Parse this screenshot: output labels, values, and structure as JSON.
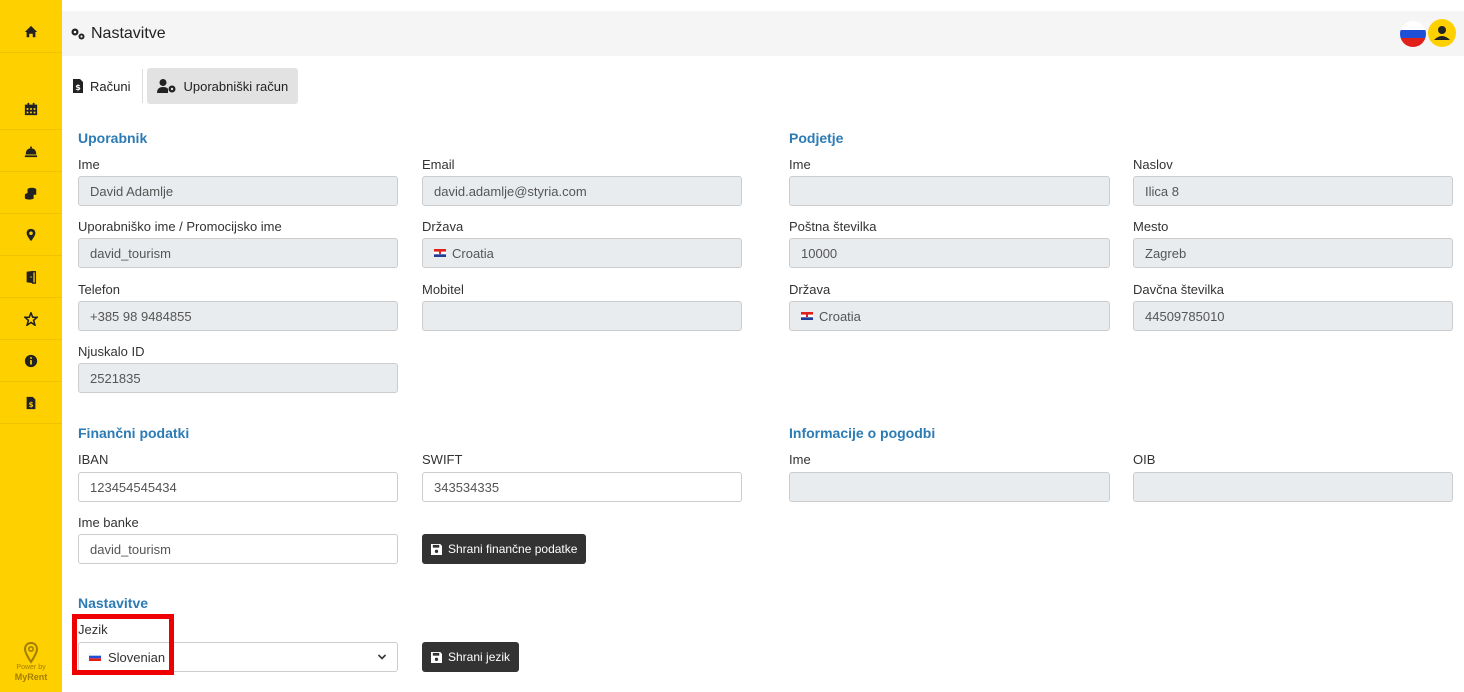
{
  "sidebar": {
    "items": [
      {
        "icon": "home-icon"
      },
      {
        "icon": "calendar-icon"
      },
      {
        "icon": "bell-icon"
      },
      {
        "icon": "coins-icon"
      },
      {
        "icon": "map-marker-icon"
      },
      {
        "icon": "door-icon"
      },
      {
        "icon": "star-icon"
      },
      {
        "icon": "info-icon"
      },
      {
        "icon": "invoice-icon"
      }
    ],
    "power_by": "Power by",
    "brand": "MyRent"
  },
  "header": {
    "title": "Nastavitve"
  },
  "tabs": [
    {
      "label": "Računi"
    },
    {
      "label": "Uporabniški račun"
    }
  ],
  "user": {
    "section": "Uporabnik",
    "name_label": "Ime",
    "name_value": "David Adamlje",
    "email_label": "Email",
    "email_value": "david.adamlje@styria.com",
    "username_label": "Uporabniško ime / Promocijsko ime",
    "username_value": "david_tourism",
    "country_label": "Država",
    "country_value": "Croatia",
    "phone_label": "Telefon",
    "phone_value": "+385 98 9484855",
    "mobile_label": "Mobitel",
    "mobile_value": "",
    "njuskalo_label": "Njuskalo ID",
    "njuskalo_value": "2521835"
  },
  "company": {
    "section": "Podjetje",
    "name_label": "Ime",
    "name_value": "",
    "address_label": "Naslov",
    "address_value": "Ilica 8",
    "postal_label": "Poštna številka",
    "postal_value": "10000",
    "city_label": "Mesto",
    "city_value": "Zagreb",
    "country_label": "Država",
    "country_value": "Croatia",
    "tax_label": "Davčna številka",
    "tax_value": "44509785010"
  },
  "finance": {
    "section": "Finančni podatki",
    "iban_label": "IBAN",
    "iban_value": "123454545434",
    "swift_label": "SWIFT",
    "swift_value": "343534335",
    "bank_label": "Ime banke",
    "bank_value": "david_tourism",
    "save_button": "Shrani finančne podatke"
  },
  "contract": {
    "section": "Informacije o pogodbi",
    "name_label": "Ime",
    "name_value": "",
    "oib_label": "OIB",
    "oib_value": ""
  },
  "settings": {
    "section": "Nastavitve",
    "language_label": "Jezik",
    "language_value": "Slovenian",
    "save_button": "Shrani jezik"
  },
  "colors": {
    "sidebar": "#ffd000",
    "section_title": "#2b7bb5",
    "highlight": "#ee0000",
    "dark_button": "#333333"
  }
}
